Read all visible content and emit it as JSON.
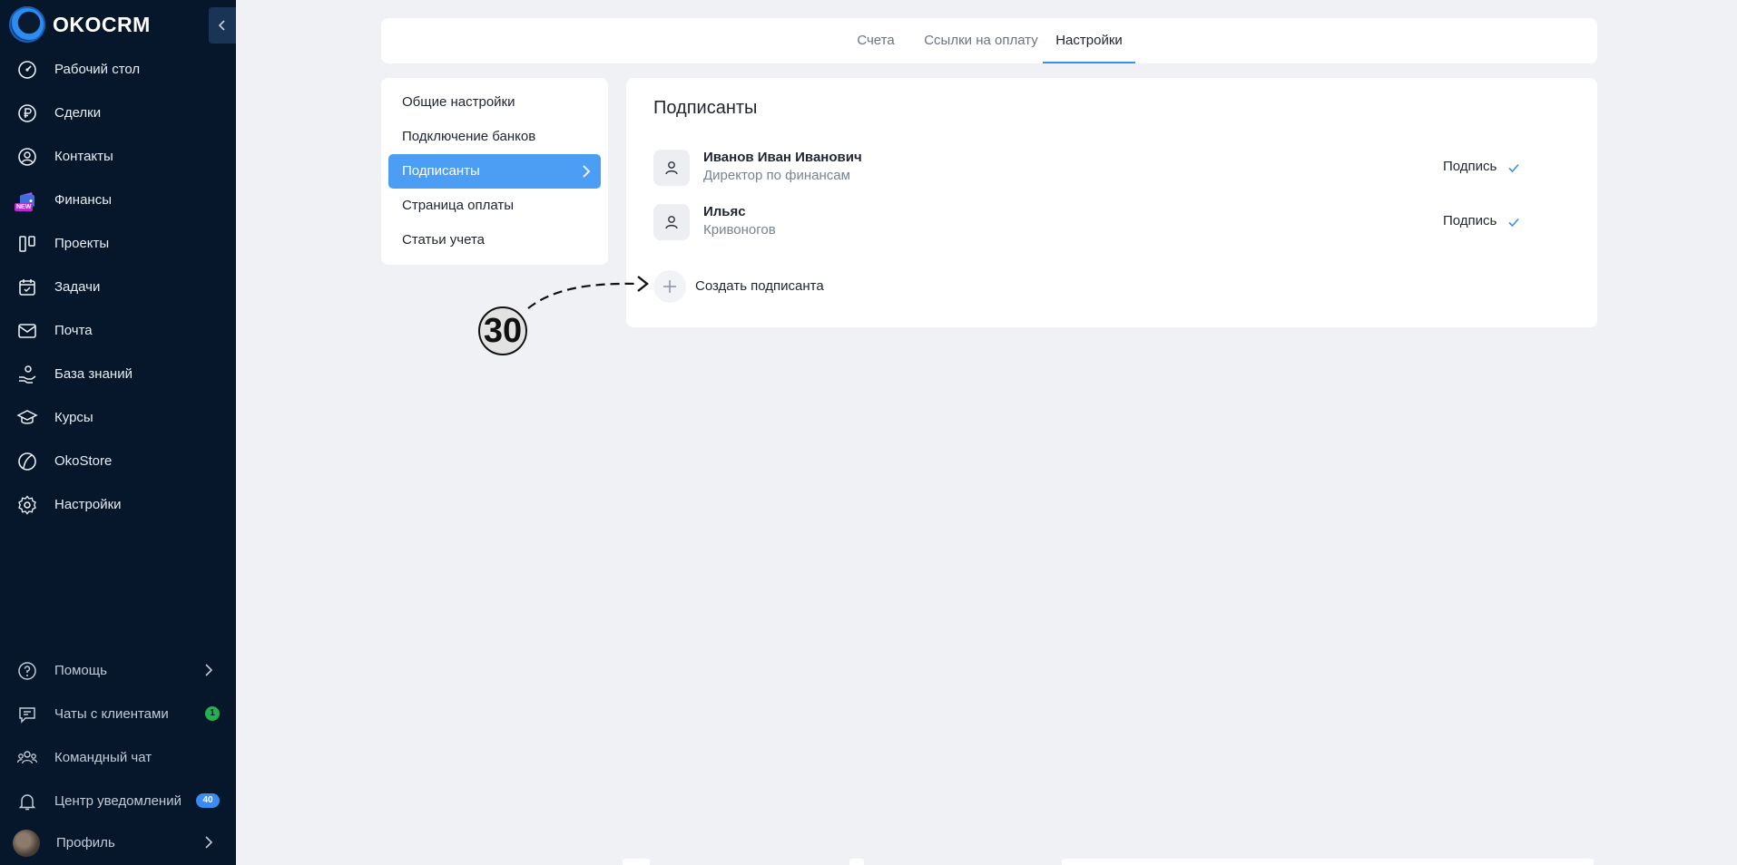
{
  "app": {
    "name": "OKOCRM"
  },
  "sidebar": {
    "items": [
      {
        "label": "Рабочий стол",
        "icon": "dashboard-icon"
      },
      {
        "label": "Сделки",
        "icon": "ruble-icon"
      },
      {
        "label": "Контакты",
        "icon": "contact-icon"
      },
      {
        "label": "Финансы",
        "icon": "finance-icon",
        "badge": "NEW"
      },
      {
        "label": "Проекты",
        "icon": "projects-icon"
      },
      {
        "label": "Задачи",
        "icon": "tasks-icon"
      },
      {
        "label": "Почта",
        "icon": "mail-icon"
      },
      {
        "label": "База знаний",
        "icon": "knowledge-icon"
      },
      {
        "label": "Курсы",
        "icon": "courses-icon"
      },
      {
        "label": "OkoStore",
        "icon": "store-icon"
      },
      {
        "label": "Настройки",
        "icon": "gear-icon"
      }
    ],
    "bottom": [
      {
        "label": "Помощь",
        "icon": "help-icon"
      },
      {
        "label": "Чаты с клиентами",
        "icon": "chat-icon",
        "count": "1"
      },
      {
        "label": "Командный чат",
        "icon": "team-icon"
      },
      {
        "label": "Центр уведомлений",
        "icon": "bell-icon",
        "count": "40"
      },
      {
        "label": "Профиль",
        "icon": "avatar"
      }
    ]
  },
  "tabs": [
    {
      "label": "Счета"
    },
    {
      "label": "Ссылки на оплату"
    },
    {
      "label": "Настройки",
      "active": true
    }
  ],
  "settings_menu": [
    {
      "label": "Общие настройки"
    },
    {
      "label": "Подключение банков"
    },
    {
      "label": "Подписанты",
      "active": true
    },
    {
      "label": "Страница оплаты"
    },
    {
      "label": "Статьи учета"
    }
  ],
  "signers": {
    "title": "Подписанты",
    "rows": [
      {
        "name": "Иванов Иван Иванович",
        "role": "Директор по финансам",
        "sign_label": "Подпись"
      },
      {
        "name": "Ильяс",
        "role": "Кривоногов",
        "sign_label": "Подпись"
      }
    ],
    "create_label": "Создать подписанта"
  },
  "annotation": {
    "step": "30"
  },
  "colors": {
    "sidebar_bg": "#06162b",
    "accent": "#3b8cf0",
    "active_menu": "#4c9ef4"
  }
}
